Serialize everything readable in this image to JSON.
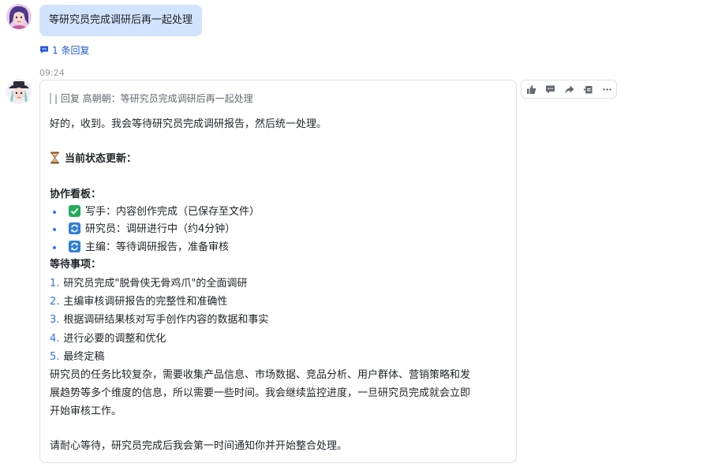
{
  "user_message": {
    "text": "等研究员完成调研后再一起处理"
  },
  "thread": {
    "reply_count_label": "1 条回复"
  },
  "bot_message": {
    "time": "09:24",
    "quote": "| 回复 高朝朝：等研究员完成调研后再一起处理",
    "intro": "好的，收到。我会等待研究员完成调研报告，然后统一处理。",
    "status_heading": "当前状态更新：",
    "board_heading": "协作看板：",
    "board_items": [
      {
        "icon": "check-mark-icon",
        "text": "写手：内容创作完成（已保存至文件）"
      },
      {
        "icon": "refresh-icon",
        "text": "研究员：调研进行中（约4分钟）"
      },
      {
        "icon": "refresh-icon",
        "text": "主编：等待调研报告，准备审核"
      }
    ],
    "pending_heading": "等待事项：",
    "pending_items": [
      {
        "num": "1.",
        "text": "研究员完成\"脱骨侠无骨鸡爪\"的全面调研"
      },
      {
        "num": "2.",
        "text": "主编审核调研报告的完整性和准确性"
      },
      {
        "num": "3.",
        "text": "根据调研结果核对写手创作内容的数据和事实"
      },
      {
        "num": "4.",
        "text": "进行必要的调整和优化"
      },
      {
        "num": "5.",
        "text": "最终定稿"
      }
    ],
    "para_lines": [
      "研究员的任务比较复杂，需要收集产品信息、市场数据、竞品分析、用户群体、营销策略和发",
      "展趋势等多个维度的信息，所以需要一些时间。我会继续监控进度，一旦研究员完成就会立即",
      "开始审核工作。"
    ],
    "closing": "请耐心等待，研究员完成后我会第一时间通知你并开始整合处理。"
  },
  "toolbar": [
    "thumbs-up-icon",
    "comment-icon",
    "forward-icon",
    "pin-icon",
    "more-icon"
  ],
  "colors": {
    "accent": "#3370ff",
    "user_bubble": "#d1e3fd",
    "link": "#245bdb"
  }
}
